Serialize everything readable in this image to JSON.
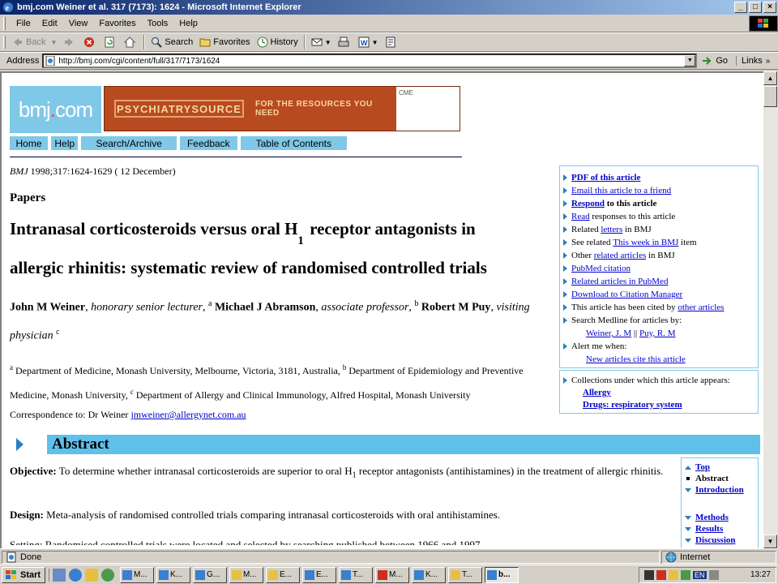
{
  "window": {
    "title": "bmj.com Weiner et al. 317 (7173): 1624 - Microsoft Internet Explorer"
  },
  "menu": [
    "File",
    "Edit",
    "View",
    "Favorites",
    "Tools",
    "Help"
  ],
  "toolbar": {
    "back": "Back",
    "search": "Search",
    "favorites": "Favorites",
    "history": "History"
  },
  "address": {
    "label": "Address",
    "url": "http://bmj.com/cgi/content/full/317/7173/1624",
    "go": "Go",
    "links": "Links"
  },
  "page": {
    "logo": "bmj.com",
    "banner": {
      "brand": "PSYCHIATRYSOURCE",
      "tagline": "FOR THE RESOURCES YOU NEED",
      "side": "CME"
    },
    "nav": [
      "Home",
      "Help",
      "Search/Archive",
      "Feedback",
      "Table of Contents"
    ],
    "citation_journal": "BMJ",
    "citation_rest": " 1998;317:1624-1629 ( 12 December)",
    "section": "Papers",
    "title_line1_a": "Intranasal corticosteroids versus oral H",
    "title_line1_sub": "1",
    "title_line1_b": " receptor antagonists in",
    "title_line2": "allergic rhinitis: systematic review of randomised controlled trials",
    "authors": {
      "a1": "John M Weiner",
      "a1_role": "honorary senior lecturer",
      "a1_sup": "a",
      "a2": "Michael J Abramson",
      "a2_role": "associate professor",
      "a2_sup": "b",
      "a3": "Robert M Puy",
      "a3_role": "visiting physician",
      "a3_sup": "c"
    },
    "affiliations": {
      "a_sup": "a",
      "a_text": " Department of Medicine, Monash University, Melbourne, Victoria, 3181, Australia, ",
      "b_sup": "b",
      "b_text": " Department of Epidemiology and Preventive Medicine, Monash University, ",
      "c_sup": "c",
      "c_text": " Department of Allergy and Clinical Immunology, Alfred Hospital, Monash University"
    },
    "correspondence_label": "Correspondence to: Dr Weiner ",
    "correspondence_email": "jmweiner@allergynet.com.au",
    "sidebox": {
      "pdf": "PDF of this article",
      "email": "Email this article to a friend",
      "respond": "Respond",
      "respond_rest": " to this article",
      "read": "Read",
      "read_rest": " responses to this article",
      "related_pre": "Related ",
      "letters": "letters",
      "related_post": " in BMJ",
      "see_pre": "See related ",
      "this_week": "This week in BMJ",
      "see_post": " item",
      "other_pre": "Other ",
      "related_articles": "related articles",
      "other_post": " in BMJ",
      "pubmed_citation": "PubMed citation",
      "related_pubmed": "Related articles in PubMed",
      "download": "Download to Citation Manager",
      "cited_pre": "This article has been cited by ",
      "other_articles": "other articles",
      "search_medline": "Search Medline for articles by:",
      "author1": "Weiner, J. M",
      "author_sep": " || ",
      "author2": "Puy, R. M",
      "alert": "Alert me when:",
      "new_articles": "New articles cite this article"
    },
    "collections": {
      "label": "Collections under which this article appears:",
      "c1": "Allergy",
      "c2": "Drugs: respiratory system"
    },
    "abstract_heading": "Abstract",
    "abstract": {
      "objective_label": "Objective:",
      "objective_a": " To determine whether intranasal corticosteroids are superior to oral H",
      "objective_sub": "1",
      "objective_b": " receptor antagonists (antihistamines) in the treatment of allergic rhinitis.",
      "design_label": "Design:",
      "design_text": " Meta-analysis of randomised controlled trials comparing intranasal corticosteroids with oral antihistamines.",
      "setting_partial": "Setting: Randomised controlled trials were located and selected by searching published between 1966 and 1997"
    },
    "toc": {
      "top": "Top",
      "abstract": "Abstract",
      "introduction": "Introduction",
      "methods": "Methods",
      "results": "Results",
      "discussion": "Discussion"
    }
  },
  "status": {
    "left": "Done",
    "zone": "Internet"
  },
  "taskbar": {
    "start": "Start",
    "tasks": [
      "M...",
      "K...",
      "G...",
      "M...",
      "E...",
      "E...",
      "T...",
      "M...",
      "K...",
      "T...",
      "b..."
    ],
    "lang": "EN",
    "clock": "13:27"
  }
}
